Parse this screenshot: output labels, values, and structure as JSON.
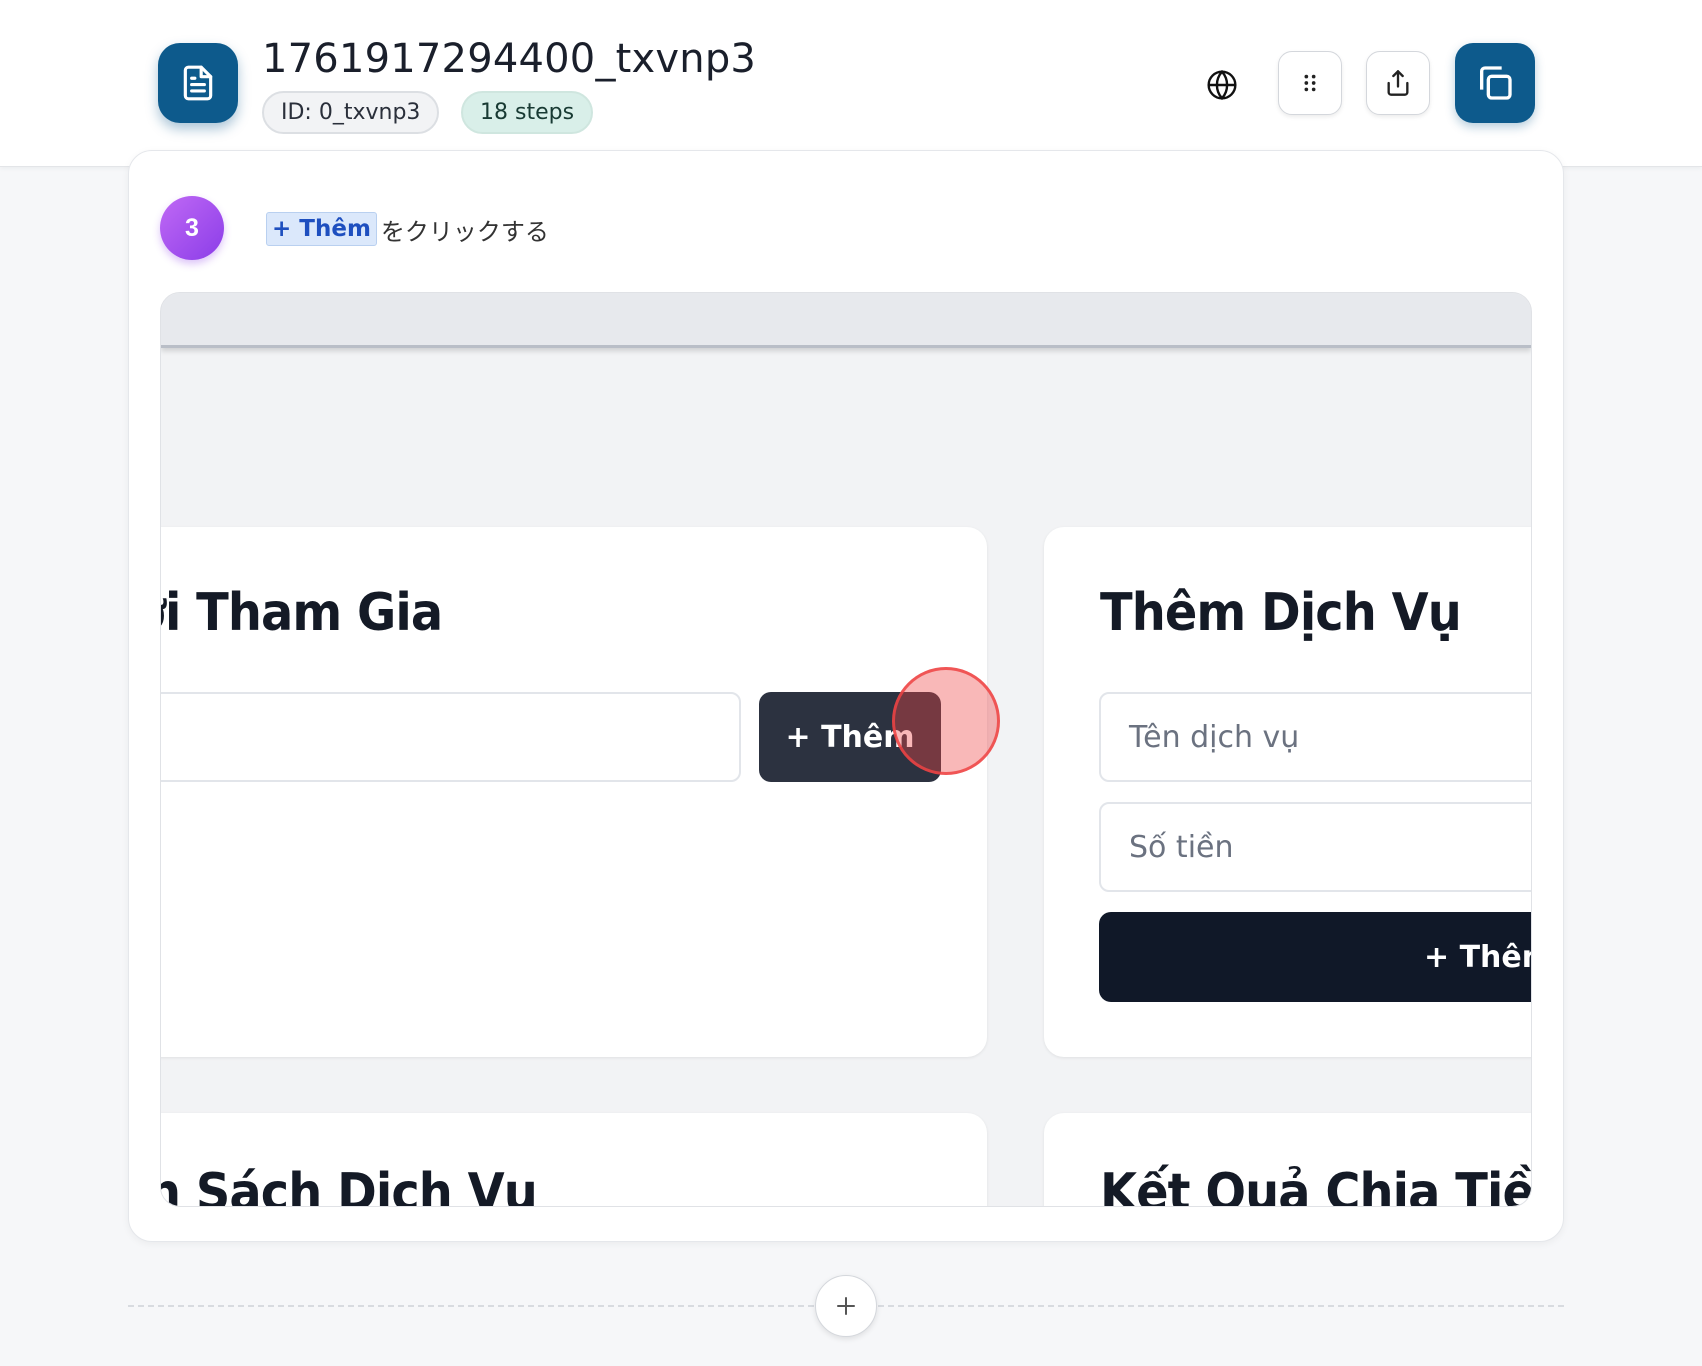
{
  "header": {
    "title": "1761917294400_txvnp3",
    "id_label": "ID: 0_txvnp3",
    "steps_label": "18 steps",
    "accent_color": "#0d5a8c",
    "icons": [
      "document-icon",
      "globe-icon",
      "drag-grid-icon",
      "share-icon",
      "copy-icon"
    ]
  },
  "step": {
    "number": "3",
    "chip_label": "+ Thêm",
    "action_text": "をクリックする"
  },
  "screenshot": {
    "card1": {
      "title": "ời Tham Gia",
      "button_label": "+ Thêm"
    },
    "card2": {
      "title": "Thêm Dịch Vụ",
      "service_placeholder": "Tên dịch vụ",
      "amount_placeholder": "Số tiền",
      "button_label": "+ Thêm"
    },
    "card3": {
      "title": "n Sách Dịch Vụ"
    },
    "card4": {
      "title": "Kết Quả Chia Tiền"
    }
  },
  "footer": {
    "add_icon": "plus-icon"
  }
}
